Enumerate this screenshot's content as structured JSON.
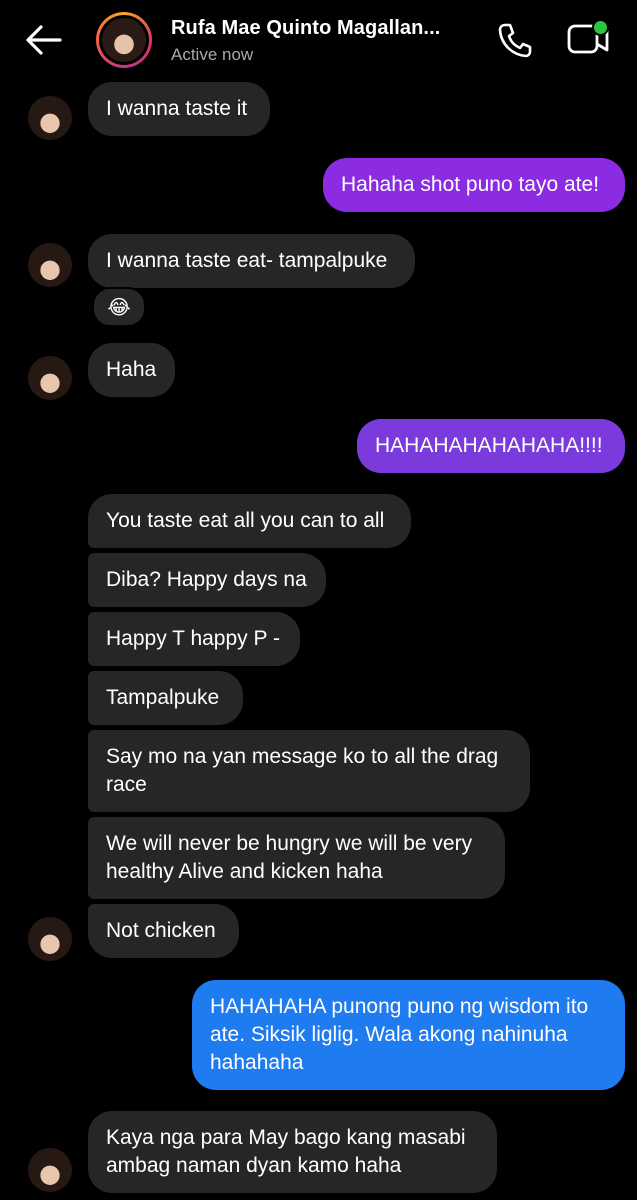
{
  "header": {
    "contact_name": "Rufa Mae Quinto Magallan...",
    "status": "Active now"
  },
  "icons": {
    "back": "arrow-left-icon",
    "call": "phone-icon",
    "video": "video-camera-icon"
  },
  "colors": {
    "incoming_bubble": "#262626",
    "outgoing_purple": "#8b2be2",
    "outgoing_purple_2": "#7b3bdc",
    "outgoing_blue": "#1e7bf0",
    "online": "#2bc640"
  },
  "messages": [
    {
      "from": "contact",
      "text": "I wanna taste it"
    },
    {
      "from": "me",
      "text": "Hahaha shot puno tayo ate!"
    },
    {
      "from": "contact",
      "text": "I wanna taste eat- tampalpuke",
      "reaction": "😂"
    },
    {
      "from": "contact",
      "text": "Haha"
    },
    {
      "from": "me",
      "text": "HAHAHAHAHAHAHA!!!!"
    },
    {
      "from": "contact",
      "text": "You taste eat all you can to all"
    },
    {
      "from": "contact",
      "text": "Diba? Happy days na"
    },
    {
      "from": "contact",
      "text": "Happy T happy P -"
    },
    {
      "from": "contact",
      "text": "Tampalpuke"
    },
    {
      "from": "contact",
      "text": "Say mo na yan message ko to all the drag race"
    },
    {
      "from": "contact",
      "text": "We will never be hungry we will be very healthy Alive and kicken haha"
    },
    {
      "from": "contact",
      "text": "Not chicken"
    },
    {
      "from": "me",
      "text": "HAHAHAHA punong puno ng wisdom ito ate. Siksik liglig. Wala akong nahinuha hahahaha"
    },
    {
      "from": "contact",
      "text": "Kaya nga para May bago kang masabi ambag naman dyan kamo haha"
    }
  ]
}
